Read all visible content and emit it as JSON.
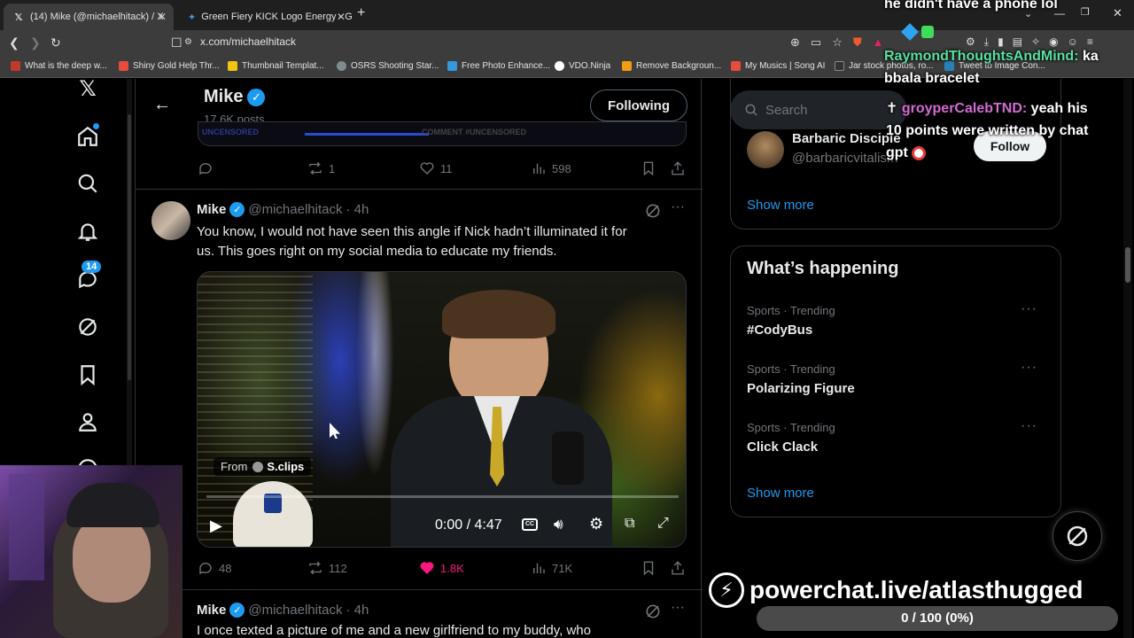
{
  "browser": {
    "tabs": [
      {
        "label": "(14) Mike (@michaelhitack) / X",
        "icon": "x-logo-icon"
      },
      {
        "label": "Green Fiery KICK Logo Energy - Goo",
        "icon": "gemini-icon"
      }
    ],
    "new_tab": "+",
    "url": "x.com/michaelhitack",
    "bookmarks": [
      {
        "label": "What is the deep w...",
        "color": "#c0392b"
      },
      {
        "label": "Shiny Gold Help Thr...",
        "color": "#e74c3c"
      },
      {
        "label": "Thumbnail Templat...",
        "color": "#f1c40f"
      },
      {
        "label": "OSRS Shooting Star...",
        "color": "#7f8c8d"
      },
      {
        "label": "Free Photo Enhance...",
        "color": "#3498db"
      },
      {
        "label": "VDO.Ninja",
        "color": "#ffffff"
      },
      {
        "label": "Remove Backgroun...",
        "color": "#f39c12"
      },
      {
        "label": "My Musics | Song AI",
        "color": "#e74c3c"
      },
      {
        "label": "Jar stock photos, ro...",
        "color": "#333333"
      },
      {
        "label": "Tweet to Image Con...",
        "color": "#2980b9"
      }
    ]
  },
  "nav": {
    "notifications_badge": "14"
  },
  "profile_header": {
    "name": "Mike",
    "posts": "17.6K posts",
    "follow_button": "Following"
  },
  "prev_post": {
    "video_caption_left": "UNCENSORED",
    "video_caption_right": "COMMENT #UNCENSORED",
    "reply": "",
    "repost": "1",
    "like": "11",
    "views": "598"
  },
  "post": {
    "name": "Mike",
    "handle": "@michaelhitack",
    "time": "· 4h",
    "text_line1": "You know, I would not have seen this angle if Nick hadn’t illuminated it for",
    "text_line2": "us. This goes right on my social media to educate my friends.",
    "video_from": "From",
    "video_source": "S.clips",
    "video_time": "0:00 / 4:47",
    "replies": "48",
    "reposts": "112",
    "likes": "1.8K",
    "views": "71K"
  },
  "next_post": {
    "name": "Mike",
    "handle": "@michaelhitack",
    "time": "· 4h",
    "text": "I once texted a picture of me and a new girlfriend to my buddy, who"
  },
  "sidebar": {
    "search_placeholder": "Search",
    "who_to_follow": {
      "name": "Barbaric Disciple",
      "handle": "@barbaricvitalism",
      "follow": "Follow",
      "show_more": "Show more"
    },
    "whats_happening": {
      "title": "What’s happening",
      "trends": [
        {
          "category": "Sports · Trending",
          "name": "#CodyBus"
        },
        {
          "category": "Sports · Trending",
          "name": "Polarizing Figure"
        },
        {
          "category": "Sports · Trending",
          "name": "Click Clack"
        }
      ],
      "show_more": "Show more"
    }
  },
  "overlay": {
    "chat_top": "he didn't have a phone lol",
    "chat1_user": "RaymondThoughtsAndMind:",
    "chat1_msg_a": "ka",
    "chat1_msg_b": "bbala bracelet",
    "chat2_user": "groyperCalebTND:",
    "chat2_msg_a": "yeah his",
    "chat2_msg_b": "10 points were written by chat",
    "chat2_msg_c": "gpt",
    "powerchat": "powerchat.live/atlasthugged",
    "progress_text": "0 / 100 (0%)",
    "progress_fraction": 0
  }
}
